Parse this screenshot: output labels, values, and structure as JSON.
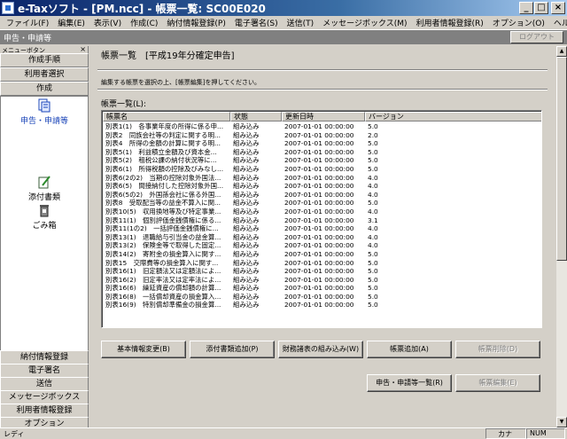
{
  "window": {
    "title": "e-Taxソフト - [PM.ncc] - 帳票一覧: SC00E020",
    "minimize": "_",
    "maximize": "□",
    "close": "×"
  },
  "menu": [
    "ファイル(F)",
    "編集(E)",
    "表示(V)",
    "作成(C)",
    "納付情報登録(P)",
    "電子署名(S)",
    "送信(T)",
    "メッセージボックス(M)",
    "利用者情報登録(R)",
    "オプション(O)",
    "ヘルプ(H)"
  ],
  "pathbar": {
    "path": "申告・申請等",
    "logout": "ログアウト"
  },
  "leftpanel": {
    "header": "メニューボタン",
    "close": "×",
    "top_buttons": [
      "作成手順",
      "利用者選択",
      "作成"
    ],
    "tools": [
      "申告・申請等",
      "添付書類",
      "ごみ箱"
    ],
    "bottom_buttons": [
      "納付情報登録",
      "電子署名",
      "送信",
      "メッセージボックス",
      "利用者情報登録",
      "オプション"
    ]
  },
  "main": {
    "heading": "帳票一覧　[平成19年分確定申告]",
    "instruction": "編集する帳票を選択の上、[帳票編集]を押してください。",
    "list_label": "帳票一覧(L):",
    "columns": [
      "帳票名",
      "状態",
      "更新日時",
      "バージョン"
    ],
    "rows": [
      [
        "別表1(1)　各事業年度の所得に係る申...",
        "組み込み",
        "2007-01-01 00:00:00",
        "5.0"
      ],
      [
        "別表2　同族会社等の判定に関する明...",
        "組み込み",
        "2007-01-01 00:00:00",
        "2.0"
      ],
      [
        "別表4　所得の金額の計算に関する明...",
        "組み込み",
        "2007-01-01 00:00:00",
        "5.0"
      ],
      [
        "別表5(1)　利益積立金額及び資本金...",
        "組み込み",
        "2007-01-01 00:00:00",
        "5.0"
      ],
      [
        "別表5(2)　租税公課の納付状況等に...",
        "組み込み",
        "2007-01-01 00:00:00",
        "5.0"
      ],
      [
        "別表6(1)　所得税額の控除及びみなし...",
        "組み込み",
        "2007-01-01 00:00:00",
        "5.0"
      ],
      [
        "別表6(2の2)　当期の控除対象外国法...",
        "組み込み",
        "2007-01-01 00:00:00",
        "4.0"
      ],
      [
        "別表6(5)　間接納付した控除対象外国...",
        "組み込み",
        "2007-01-01 00:00:00",
        "4.0"
      ],
      [
        "別表6(5の2)　外国孫会社に係る外国...",
        "組み込み",
        "2007-01-01 00:00:00",
        "4.0"
      ],
      [
        "別表8　受取配当等の益金不算入に関...",
        "組み込み",
        "2007-01-01 00:00:00",
        "5.0"
      ],
      [
        "別表10(5)　収用換地等及び特定事業...",
        "組み込み",
        "2007-01-01 00:00:00",
        "4.0"
      ],
      [
        "別表11(1)　個別評価金銭債権に係る...",
        "組み込み",
        "2007-01-01 00:00:00",
        "3.1"
      ],
      [
        "別表11(1の2)　一括評価金銭債権に...",
        "組み込み",
        "2007-01-01 00:00:00",
        "4.0"
      ],
      [
        "別表13(1)　退職給与引当金の益金算...",
        "組み込み",
        "2007-01-01 00:00:00",
        "4.0"
      ],
      [
        "別表13(2)　保険金等で取得した固定...",
        "組み込み",
        "2007-01-01 00:00:00",
        "4.0"
      ],
      [
        "別表14(2)　寄附金の損金算入に関す...",
        "組み込み",
        "2007-01-01 00:00:00",
        "5.0"
      ],
      [
        "別表15　交際費等の損金算入に関す...",
        "組み込み",
        "2007-01-01 00:00:00",
        "5.0"
      ],
      [
        "別表16(1)　旧定額法又は定額法によ...",
        "組み込み",
        "2007-01-01 00:00:00",
        "5.0"
      ],
      [
        "別表16(2)　旧定率法又は定率法によ...",
        "組み込み",
        "2007-01-01 00:00:00",
        "5.0"
      ],
      [
        "別表16(6)　繰延資産の償却額の計算...",
        "組み込み",
        "2007-01-01 00:00:00",
        "5.0"
      ],
      [
        "別表16(8)　一括償却資産の損金算入...",
        "組み込み",
        "2007-01-01 00:00:00",
        "5.0"
      ],
      [
        "別表16(9)　特別償却準備金の損金算...",
        "組み込み",
        "2007-01-01 00:00:00",
        "5.0"
      ]
    ],
    "buttons_row1": [
      "基本情報変更(B)",
      "添付書類追加(P)",
      "財務諸表の組み込み(W)",
      "帳票追加(A)",
      "帳票削除(D)"
    ],
    "buttons_row2": [
      "申告・申請等一覧(R)",
      "帳票編集(E)"
    ]
  },
  "statusbar": {
    "left": "レディ",
    "kana": "カナ",
    "num": "NUM"
  }
}
